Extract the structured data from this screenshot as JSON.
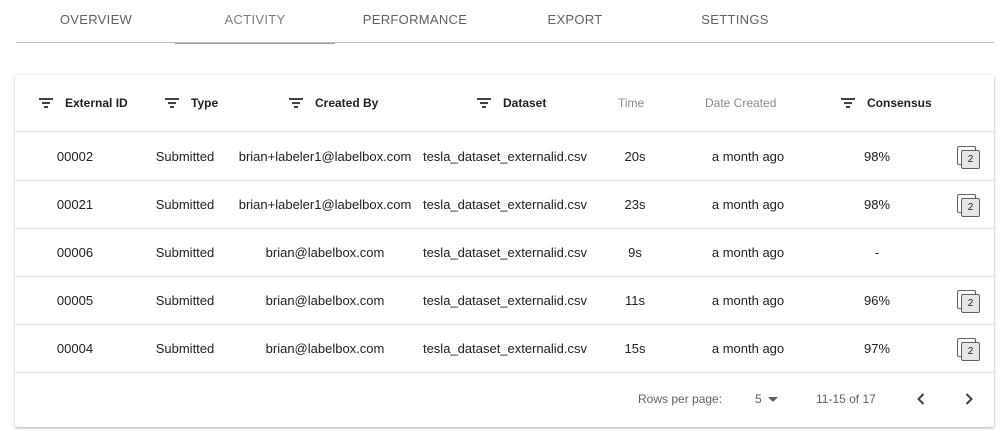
{
  "tabs": [
    {
      "label": "OVERVIEW",
      "active": false
    },
    {
      "label": "ACTIVITY",
      "active": true
    },
    {
      "label": "PERFORMANCE",
      "active": false
    },
    {
      "label": "EXPORT",
      "active": false
    },
    {
      "label": "SETTINGS",
      "active": false
    }
  ],
  "table": {
    "columns": {
      "external_id": "External ID",
      "type": "Type",
      "created_by": "Created By",
      "dataset": "Dataset",
      "time": "Time",
      "date_created": "Date Created",
      "consensus": "Consensus"
    },
    "rows": [
      {
        "external_id": "00002",
        "type": "Submitted",
        "created_by": "brian+labeler1@labelbox.com",
        "dataset": "tesla_dataset_externalid.csv",
        "time": "20s",
        "date_created": "a month ago",
        "consensus": "98%",
        "badge": "2"
      },
      {
        "external_id": "00021",
        "type": "Submitted",
        "created_by": "brian+labeler1@labelbox.com",
        "dataset": "tesla_dataset_externalid.csv",
        "time": "23s",
        "date_created": "a month ago",
        "consensus": "98%",
        "badge": "2"
      },
      {
        "external_id": "00006",
        "type": "Submitted",
        "created_by": "brian@labelbox.com",
        "dataset": "tesla_dataset_externalid.csv",
        "time": "9s",
        "date_created": "a month ago",
        "consensus": "-",
        "badge": ""
      },
      {
        "external_id": "00005",
        "type": "Submitted",
        "created_by": "brian@labelbox.com",
        "dataset": "tesla_dataset_externalid.csv",
        "time": "11s",
        "date_created": "a month ago",
        "consensus": "96%",
        "badge": "2"
      },
      {
        "external_id": "00004",
        "type": "Submitted",
        "created_by": "brian@labelbox.com",
        "dataset": "tesla_dataset_externalid.csv",
        "time": "15s",
        "date_created": "a month ago",
        "consensus": "97%",
        "badge": "2"
      }
    ]
  },
  "pagination": {
    "rows_per_page_label": "Rows per page:",
    "rows_per_page": "5",
    "range": "11-15 of 17"
  },
  "icons": {
    "filter": "filter-icon",
    "badge": "copy-count-icon",
    "prev": "chevron-left-icon",
    "next": "chevron-right-icon",
    "dropdown": "caret-down-icon"
  },
  "colors": {
    "tab_indicator": "#9e9e9e",
    "divider": "#e0e0e0",
    "text": "#212121"
  }
}
